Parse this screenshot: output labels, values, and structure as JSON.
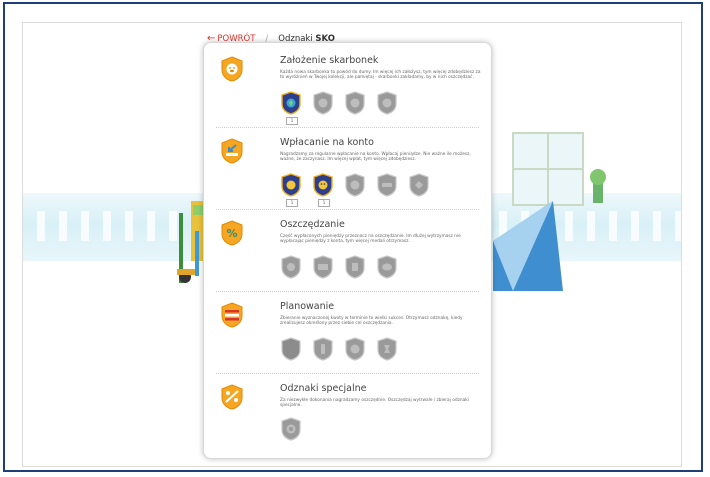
{
  "nav": {
    "back_label": "POWRÓT",
    "separator": "/",
    "title_prefix": "Odznaki",
    "title_bold": "SKO"
  },
  "sections": [
    {
      "title": "Założenie skarbonek",
      "desc": "Każda nowa skarbonka to powód do dumy. Im więcej ich założysz, tym więcej zdobędziesz za to wyróżnień w Twojej kolekcji, ale pamiętaj - skarbonki zakładamy, by w nich oszczędzać.",
      "badges": [
        {
          "state": "earned",
          "count": "1"
        },
        {
          "state": "locked"
        },
        {
          "state": "locked"
        },
        {
          "state": "locked"
        }
      ]
    },
    {
      "title": "Wpłacanie na konto",
      "desc": "Nagradzamy za regularne wpłacanie na konto. Wpłacaj pieniądze. Nie ważne ile możesz, ważne, że zaczynasz. Im więcej wpłat, tym więcej zdobędziesz.",
      "badges": [
        {
          "state": "earned",
          "count": "1"
        },
        {
          "state": "earned",
          "count": "1"
        },
        {
          "state": "locked"
        },
        {
          "state": "locked"
        },
        {
          "state": "locked"
        }
      ]
    },
    {
      "title": "Oszczędzanie",
      "desc": "Część wypłaconych pieniędzy przeznacz na oszczędzanie. Im dłużej wytrzymasz nie wypłacając pieniędzy z konta, tym więcej medali otrzymasz.",
      "badges": [
        {
          "state": "locked"
        },
        {
          "state": "locked"
        },
        {
          "state": "locked"
        },
        {
          "state": "locked"
        }
      ]
    },
    {
      "title": "Planowanie",
      "desc": "Zbieranie wyznaczonej kwoty w terminie to wielki sukces. Otrzymasz odznakę, kiedy zrealizujesz określony przez siebie cel oszczędzania.",
      "badges": [
        {
          "state": "locked"
        },
        {
          "state": "locked"
        },
        {
          "state": "locked"
        },
        {
          "state": "locked"
        }
      ]
    },
    {
      "title": "Odznaki specjalne",
      "desc": "Za niezwykłe dokonania nagradzamy oszczędnie. Oszczędzaj wytrwale i zbieraj odznaki specjalne.",
      "badges": [
        {
          "state": "locked"
        }
      ]
    }
  ],
  "colors": {
    "accent": "#d9362b",
    "frame": "#1f3f7a",
    "shield_orange": "#f5a623",
    "badge_earned": "#2d3f8c",
    "badge_locked": "#9a9a9a"
  }
}
